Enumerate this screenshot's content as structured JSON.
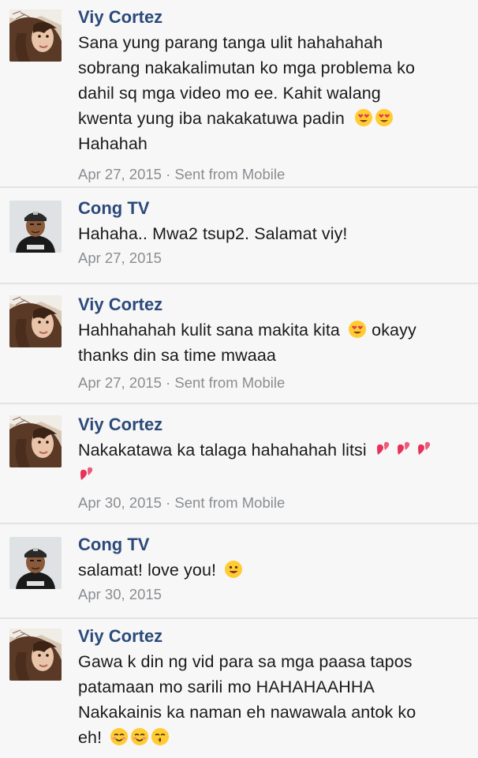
{
  "messages": [
    {
      "sender": "Viy Cortez",
      "text_lines": [
        "Sana yung parang tanga ulit hahahahah",
        "sobrang nakakalimutan ko mga problema ko",
        "dahil sq mga video mo ee. Kahit walang",
        "kwenta yung iba nakakatuwa padin",
        "Hahahah"
      ],
      "date": "Apr 27, 2015",
      "sent_from": "Sent from Mobile"
    },
    {
      "sender": "Cong TV",
      "text_lines": [
        "Hahaha.. Mwa2 tsup2. Salamat viy!"
      ],
      "date": "Apr 27, 2015"
    },
    {
      "sender": "Viy Cortez",
      "text_lines": [
        "Hahhahahah kulit sana makita kita",
        "okayy",
        "thanks din sa time mwaaa"
      ],
      "date": "Apr 27, 2015",
      "sent_from": "Sent from Mobile"
    },
    {
      "sender": "Viy Cortez",
      "text_lines": [
        "Nakakatawa ka talaga hahahahah litsi"
      ],
      "date": "Apr 30, 2015",
      "sent_from": "Sent from Mobile"
    },
    {
      "sender": "Cong TV",
      "text_lines": [
        "salamat! love you!"
      ],
      "date": "Apr 30, 2015"
    },
    {
      "sender": "Viy Cortez",
      "text_lines": [
        "Gawa k din ng vid para sa mga paasa tapos",
        "patamaan mo sarili mo HAHAHAAHHA",
        "Nakakainis ka naman eh nawawala antok ko",
        "eh!"
      ]
    }
  ],
  "separator": "·",
  "colors": {
    "sender_name": "#2b4a7a",
    "meta": "#8a8d91",
    "divider": "#e3e3e3",
    "background": "#f7f7f7"
  },
  "icons": {
    "viy_avatar": "girl-profile-photo",
    "cong_avatar": "boy-profile-photo-cap",
    "heart_eyes": "heart-eyes-emoji",
    "two_hearts": "two-hearts-emoji",
    "smile": "smile-emoji",
    "blush": "blushing-smile-emoji",
    "kiss": "kissing-emoji"
  }
}
